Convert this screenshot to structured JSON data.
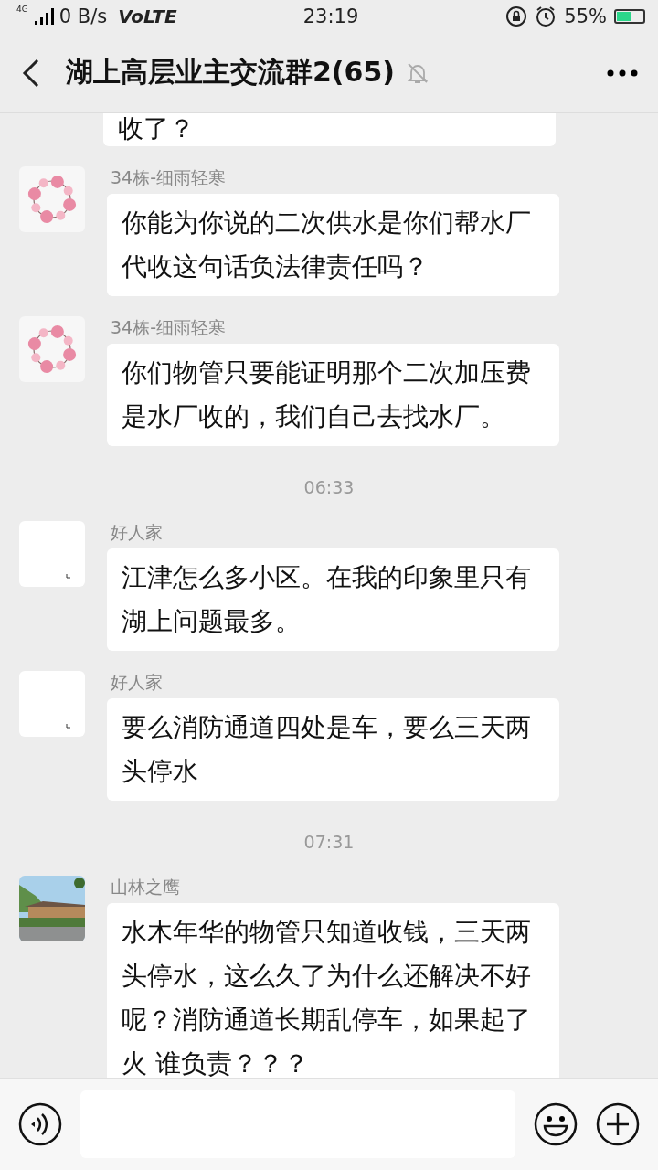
{
  "status_bar": {
    "network": "4G",
    "speed": "0 B/s",
    "volte": "VoLTE",
    "time": "23:19",
    "battery": "55%"
  },
  "header": {
    "title": "湖上高层业主交流群2(65)",
    "muted": true
  },
  "messages": [
    {
      "kind": "partial",
      "text": "收了？"
    },
    {
      "kind": "message",
      "sender": "34栋-细雨轻寒",
      "avatar": {
        "kind": "wreath"
      },
      "text": "你能为你说的二次供水是你们帮水厂代收这句话负法律责任吗？"
    },
    {
      "kind": "message",
      "sender": "34栋-细雨轻寒",
      "avatar": {
        "kind": "wreath"
      },
      "text": "你们物管只要能证明那个二次加压费是水厂收的，我们自己去找水厂。"
    },
    {
      "kind": "time",
      "text": "06:33"
    },
    {
      "kind": "message",
      "sender": "好人家",
      "avatar": {
        "kind": "blank"
      },
      "text": "江津怎么多小区。在我的印象里只有湖上问题最多。"
    },
    {
      "kind": "message",
      "sender": "好人家",
      "avatar": {
        "kind": "blank"
      },
      "text": "要么消防通道四处是车，要么三天两头停水"
    },
    {
      "kind": "time",
      "text": "07:31"
    },
    {
      "kind": "message",
      "sender": "山林之鹰",
      "text": "水木年华的物管只知道收钱，三天两头停水，这么久了为什么还解决不好呢？消防通道长期乱停车，如果起了火 谁负责？？？"
    }
  ]
}
